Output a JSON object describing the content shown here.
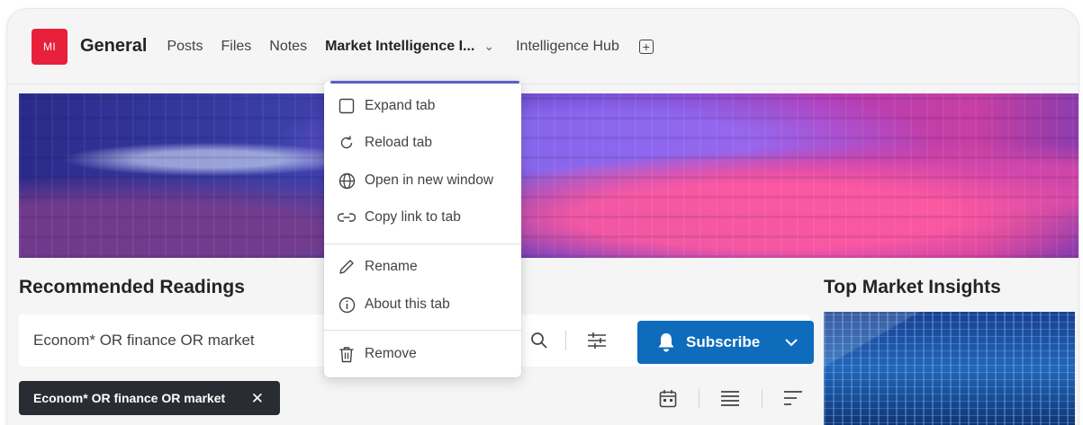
{
  "header": {
    "avatar_initials": "MI",
    "avatar_color": "#e8203b",
    "channel_title": "General",
    "tabs": [
      {
        "label": "Posts"
      },
      {
        "label": "Files"
      },
      {
        "label": "Notes"
      },
      {
        "label": "Market Intelligence I..."
      },
      {
        "label": "Intelligence Hub"
      }
    ],
    "active_tab_index": 3,
    "add_tab_icon": "add-square-icon"
  },
  "tab_menu": {
    "accent_color": "#5b5fc7",
    "items": [
      {
        "label": "Expand tab",
        "icon": "expand-icon"
      },
      {
        "label": "Reload tab",
        "icon": "reload-icon"
      },
      {
        "label": "Open in new window",
        "icon": "globe-icon"
      },
      {
        "label": "Copy link to tab",
        "icon": "link-icon"
      },
      {
        "label": "Rename",
        "icon": "pencil-icon"
      },
      {
        "label": "About this tab",
        "icon": "info-icon"
      },
      {
        "label": "Remove",
        "icon": "trash-icon"
      }
    ]
  },
  "main": {
    "recommended_title": "Recommended Readings",
    "search_query": "Econom* OR finance OR market",
    "subscribe_label": "Subscribe",
    "subscribe_color": "#0f6cbd",
    "active_filter_chip": "Econom* OR finance OR market",
    "toolbar_icons": [
      "calendar-icon",
      "list-view-icon",
      "sort-icon"
    ]
  },
  "sidebar": {
    "insights_title": "Top Market Insights"
  }
}
